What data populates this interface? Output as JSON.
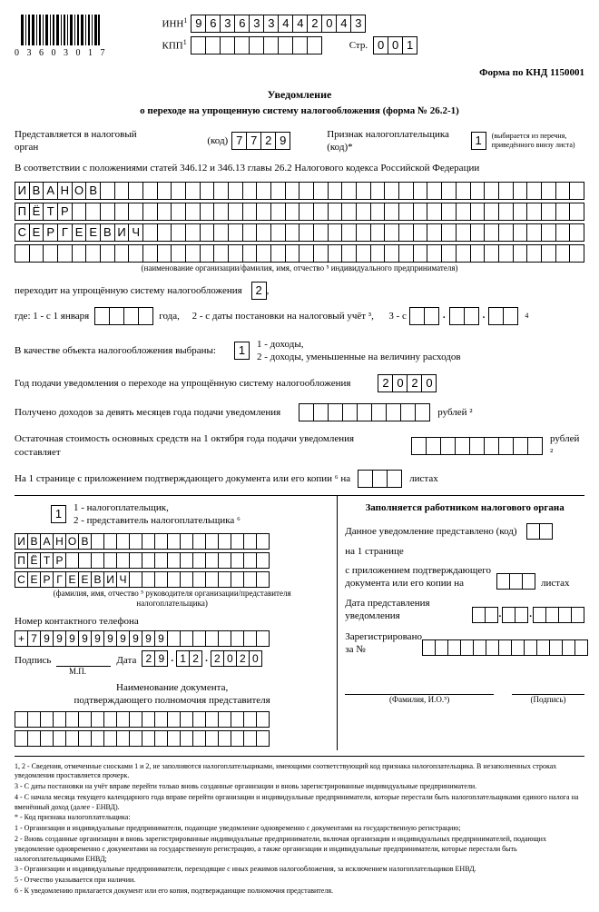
{
  "barcode_number": "0 3 6 0 3 0 1 7",
  "header": {
    "inn_label": "ИНН",
    "inn": [
      "9",
      "6",
      "3",
      "6",
      "3",
      "3",
      "4",
      "4",
      "2",
      "0",
      "4",
      "3"
    ],
    "kpp_label": "КПП",
    "kpp": [
      "",
      "",
      "",
      "",
      "",
      "",
      "",
      "",
      ""
    ],
    "page_label": "Стр.",
    "page": [
      "0",
      "0",
      "1"
    ],
    "form_code": "Форма по КНД 1150001"
  },
  "title1": "Уведомление",
  "title2": "о переходе на упрощенную систему налогообложения (форма № 26.2-1)",
  "line_org": {
    "t1": "Представляется в налоговый орган",
    "code_lbl": "(код)",
    "code": [
      "7",
      "7",
      "2",
      "9"
    ],
    "t2": "Признак налогоплательщика (код)*",
    "val": "1",
    "hint": "(выбирается из перечня, приведённого внизу листа)"
  },
  "law": "В соответствии с положениями статей 346.12 и 346.13 главы 26.2 Налогового кодекса Российской Федерации",
  "name1": [
    "И",
    "В",
    "А",
    "Н",
    "О",
    "В"
  ],
  "name2": [
    "П",
    "Ё",
    "Т",
    "Р"
  ],
  "name3": [
    "С",
    "Е",
    "Р",
    "Г",
    "Е",
    "Е",
    "В",
    "И",
    "Ч"
  ],
  "name_note": "(наименование организации/фамилия, имя, отчество ⁵ индивидуального предпринимателя)",
  "goto": {
    "t": "переходит на упрощённую систему налогообложения",
    "val": "2"
  },
  "where": {
    "pre": "где: 1 - с 1 января",
    "year": [
      "",
      "",
      "",
      ""
    ],
    "mid": "года,     2 - с даты постановки на налоговый учёт ³,      3 - с"
  },
  "object": {
    "t": "В качестве объекта налогообложения выбраны:",
    "val": "1",
    "opt1": "1 - доходы,",
    "opt2": "2 - доходы, уменьшенные на величину расходов"
  },
  "year_row": {
    "t": "Год подачи уведомления о переходе на упрощённую систему налогообложения",
    "val": [
      "2",
      "0",
      "2",
      "0"
    ]
  },
  "income": {
    "t": "Получено доходов за девять месяцев года подачи уведомления",
    "unit": "рублей ²"
  },
  "residual": {
    "t": "Остаточная стоимость основных средств на 1 октября года подачи уведомления составляет",
    "unit": "рублей ²"
  },
  "pages_line": {
    "a": "На 1 странице с приложением подтверждающего документа или его копии ⁶ на",
    "b": "листах"
  },
  "left": {
    "who_val": "1",
    "who1": "1 - налогоплательщик,",
    "who2": "2 - представитель налогоплательщика ⁶",
    "n1": [
      "И",
      "В",
      "А",
      "Н",
      "О",
      "В"
    ],
    "n2": [
      "П",
      "Ё",
      "Т",
      "Р"
    ],
    "n3": [
      "С",
      "Е",
      "Р",
      "Г",
      "Е",
      "Е",
      "В",
      "И",
      "Ч"
    ],
    "fio_note": "(фамилия, имя, отчество ⁵ руководителя организации/представителя\nналогоплательщика)",
    "phone_lbl": "Номер контактного телефона",
    "phone": [
      "+",
      "7",
      "9",
      "9",
      "9",
      "9",
      "9",
      "9",
      "9",
      "9",
      "9",
      "9"
    ],
    "sign_lbl": "Подпись",
    "mp": "М.П.",
    "date_lbl": "Дата",
    "date_d": [
      "2",
      "9"
    ],
    "date_m": [
      "1",
      "2"
    ],
    "date_y": [
      "2",
      "0",
      "2",
      "0"
    ],
    "doc_title": "Наименование документа,\nподтверждающего полномочия представителя"
  },
  "right": {
    "title": "Заполняется работником налогового органа",
    "r1": "Данное уведомление представлено (код)",
    "r2": "на 1 странице",
    "r3a": "с приложением подтверждающего",
    "r3b": "документа или его копии на",
    "r3c": "листах",
    "r4a": "Дата представления",
    "r4b": "уведомления",
    "r5a": "Зарегистрировано",
    "r5b": "за №",
    "sig1": "(Фамилия, И.О.⁵)",
    "sig2": "(Подпись)"
  },
  "footnotes": [
    "1, 2 - Сведения, отмеченные сносками 1 и 2, не заполняются налогоплательщиками, имеющими соответствующий код признака налогоплательщика. В незаполненных строках уведомления проставляется прочерк.",
    "3 - С даты постановки на учёт вправе перейти только вновь созданные организации и вновь зарегистрированные индивидуальные предприниматели.",
    "4 - С начала месяца текущего календарного года вправе перейти организации и индивидуальные предприниматели, которые перестали быть налогоплательщиками единого налога на вменённый доход (далее - ЕНВД).",
    "* - Код признака налогоплательщика:",
    "1 - Организации и индивидуальные предприниматели, подающие уведомление одновременно с документами на государственную регистрацию;",
    "2 - Вновь созданные организации и вновь зарегистрированные индивидуальные предприниматели, включая организации и индивидуальных предпринимателей, подающих уведомление одновременно с документами на государственную регистрацию, а также организации и индивидуальные предприниматели, которые перестали быть налогоплательщиками ЕНВД;",
    "3 - Организации и индивидуальные предприниматели, переходящие с иных режимов налогообложения, за исключением налогоплательщиков ЕНВД.",
    "5 - Отчество указывается при наличии.",
    "6 - К уведомлению прилагается документ или его копия, подтверждающие полномочия представителя."
  ]
}
